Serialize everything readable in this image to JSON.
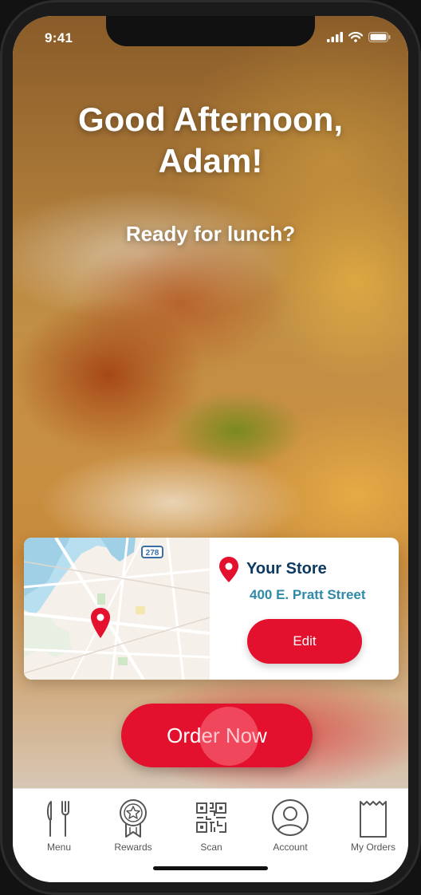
{
  "status_bar": {
    "time": "9:41"
  },
  "greeting": {
    "line1": "Good Afternoon,",
    "line2": "Adam!",
    "subtitle": "Ready for lunch?"
  },
  "store": {
    "title": "Your Store",
    "address": "400 E. Pratt Street",
    "edit_label": "Edit",
    "map_route": "278"
  },
  "order": {
    "label": "Order Now"
  },
  "tabs": [
    {
      "label": "Menu",
      "icon": "fork-knife-icon"
    },
    {
      "label": "Rewards",
      "icon": "star-badge-icon"
    },
    {
      "label": "Scan",
      "icon": "qr-code-icon"
    },
    {
      "label": "Account",
      "icon": "user-circle-icon"
    },
    {
      "label": "My Orders",
      "icon": "bag-icon"
    }
  ],
  "colors": {
    "brand_red": "#e3102e",
    "store_title": "#0d3a60",
    "address": "#2f89a8"
  }
}
